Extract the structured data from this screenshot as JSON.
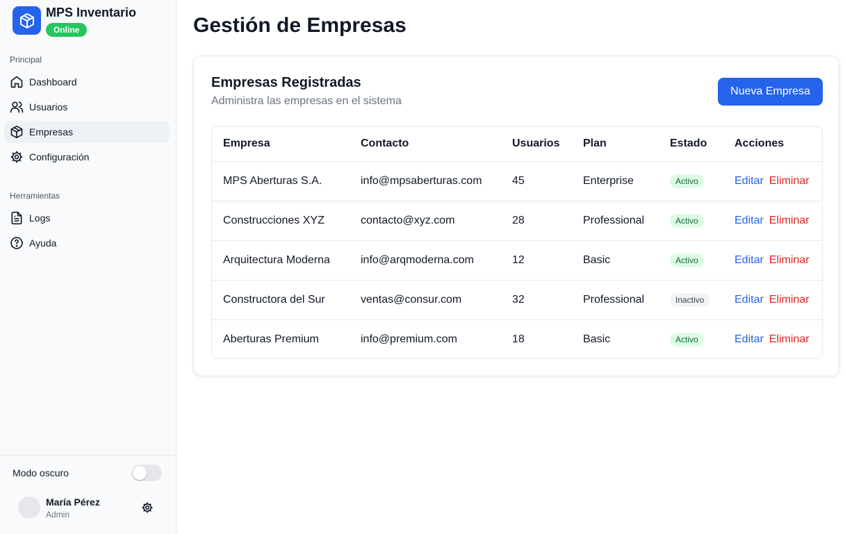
{
  "app": {
    "title": "MPS Inventario",
    "status": "Online"
  },
  "sidebar": {
    "sections": [
      {
        "label": "Principal"
      },
      {
        "label": "Herramientas"
      }
    ],
    "items": [
      {
        "label": "Dashboard",
        "icon": "home-icon"
      },
      {
        "label": "Usuarios",
        "icon": "users-icon"
      },
      {
        "label": "Empresas",
        "icon": "package-icon",
        "active": true
      },
      {
        "label": "Configuración",
        "icon": "gear-icon"
      },
      {
        "label": "Logs",
        "icon": "document-icon"
      },
      {
        "label": "Ayuda",
        "icon": "help-icon"
      }
    ],
    "dark_mode_label": "Modo oscuro",
    "dark_mode_on": false,
    "user": {
      "name": "María Pérez",
      "role": "Admin"
    }
  },
  "main": {
    "title": "Gestión de Empresas",
    "card": {
      "title": "Empresas Registradas",
      "subtitle": "Administra las empresas en el sistema",
      "new_button": "Nueva Empresa"
    },
    "table": {
      "headers": [
        "Empresa",
        "Contacto",
        "Usuarios",
        "Plan",
        "Estado",
        "Acciones"
      ],
      "edit_label": "Editar",
      "delete_label": "Eliminar",
      "rows": [
        {
          "empresa": "MPS Aberturas S.A.",
          "contacto": "info@mpsaberturas.com",
          "usuarios": "45",
          "plan": "Enterprise",
          "estado": "Activo"
        },
        {
          "empresa": "Construcciones XYZ",
          "contacto": "contacto@xyz.com",
          "usuarios": "28",
          "plan": "Professional",
          "estado": "Activo"
        },
        {
          "empresa": "Arquitectura Moderna",
          "contacto": "info@arqmoderna.com",
          "usuarios": "12",
          "plan": "Basic",
          "estado": "Activo"
        },
        {
          "empresa": "Constructora del Sur",
          "contacto": "ventas@consur.com",
          "usuarios": "32",
          "plan": "Professional",
          "estado": "Inactivo"
        },
        {
          "empresa": "Aberturas Premium",
          "contacto": "info@premium.com",
          "usuarios": "18",
          "plan": "Basic",
          "estado": "Activo"
        }
      ]
    }
  },
  "colors": {
    "primary": "#2563eb",
    "online": "#22c55e",
    "danger": "#dc2626",
    "active_bg": "#dcfce7",
    "active_text": "#166534"
  }
}
